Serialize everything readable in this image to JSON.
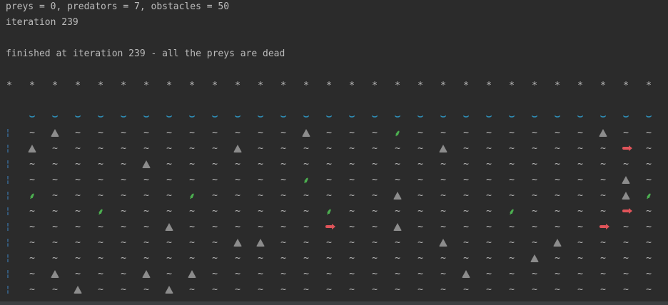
{
  "console": {
    "status_line": "preys = 0, predators = 7, obstacles = 50",
    "iteration_line": "iteration 239",
    "finish_line": "finished at iteration 239 - all the preys are dead"
  },
  "grid": {
    "columns": 29,
    "symbols": {
      "star": "*",
      "water": "~",
      "wave": "⌣",
      "margin": "¦",
      "plant": "⸙"
    },
    "rows": [
      "~R~~~~~~~~~~R~~~P~~~~~~~~R~~",
      "R~~~~~~~~R~~~~~~~~R~~~~~~~F~",
      "~~~~~R~~~~~~~~~~~~~~~~~~~~~~",
      "~~~~~~~~~~~~P~~~~~~~~~~~~~R~",
      "P~~~~~~P~~~~~~~~R~~~~~~~~~RP",
      "~~~P~~~~~~~~~P~~~~~~~P~~~~F~",
      "~~~~~~R~~~~~~F~~R~~~~~~~~F~~",
      "~~~~~~~~~RR~~~~~~~R~~~~R~~~~",
      "~~~~~~~~~~~~~~~~~~~~~~R~~~~~",
      "~R~~~R~R~~~~~~~~~~~R~~~~~~~~",
      "~~R~~~R~~~~~~~~~~~~~~~~~~~~~"
    ]
  }
}
